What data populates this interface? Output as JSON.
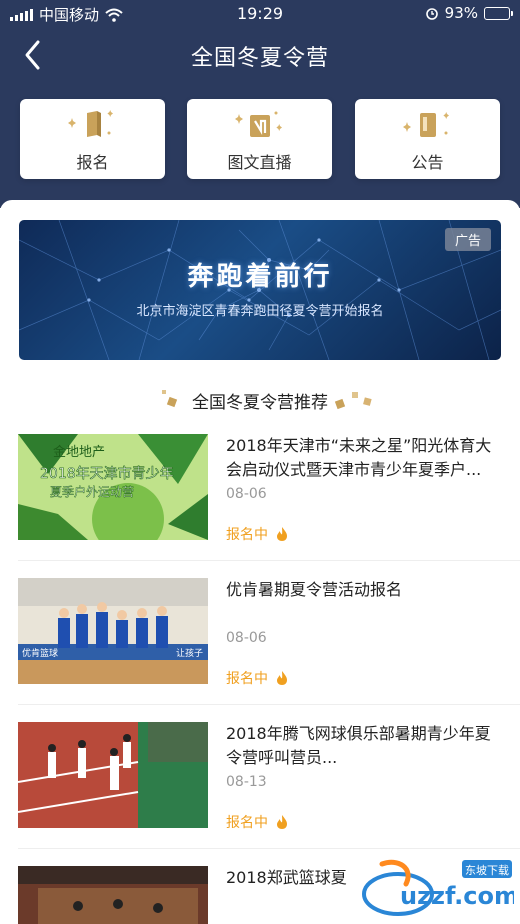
{
  "status_bar": {
    "carrier": "中国移动",
    "time": "19:29",
    "battery": "93%",
    "battery_level": 0.93
  },
  "nav": {
    "title": "全国冬夏令营",
    "back_icon": "chevron-left-icon"
  },
  "quick_cards": [
    {
      "label": "报名",
      "icon": "signup-book-icon"
    },
    {
      "label": "图文直播",
      "icon": "live-broadcast-icon"
    },
    {
      "label": "公告",
      "icon": "notice-board-icon"
    }
  ],
  "banner": {
    "badge": "广告",
    "title": "奔跑着前行",
    "subtitle": "北京市海淀区青春奔跑田径夏令营开始报名"
  },
  "section": {
    "title": "全国冬夏令营推荐"
  },
  "list": [
    {
      "title": "2018年天津市“未来之星”阳光体育大会启动仪式暨天津市青少年夏季户...",
      "date": "08-06",
      "status": "报名中",
      "thumb_text_1": "金地地产",
      "thumb_text_2": "2018年天津市青少年",
      "thumb_text_3": "夏季户外运动营"
    },
    {
      "title": "优肯暑期夏令营活动报名",
      "date": "08-06",
      "status": "报名中",
      "thumb_text_1": "优肯篮球",
      "thumb_text_2": "让孩子"
    },
    {
      "title": "2018年腾飞网球俱乐部暑期青少年夏令营呼叫营员...",
      "date": "08-13",
      "status": "报名中"
    },
    {
      "title": "2018郑武篮球夏"
    }
  ],
  "watermark": {
    "brand": "uzzf.com",
    "tag": "东坡下载"
  },
  "colors": {
    "header_bg": "#2b3a5e",
    "accent_gold": "#c9a25a",
    "status_orange": "#f0a020"
  }
}
